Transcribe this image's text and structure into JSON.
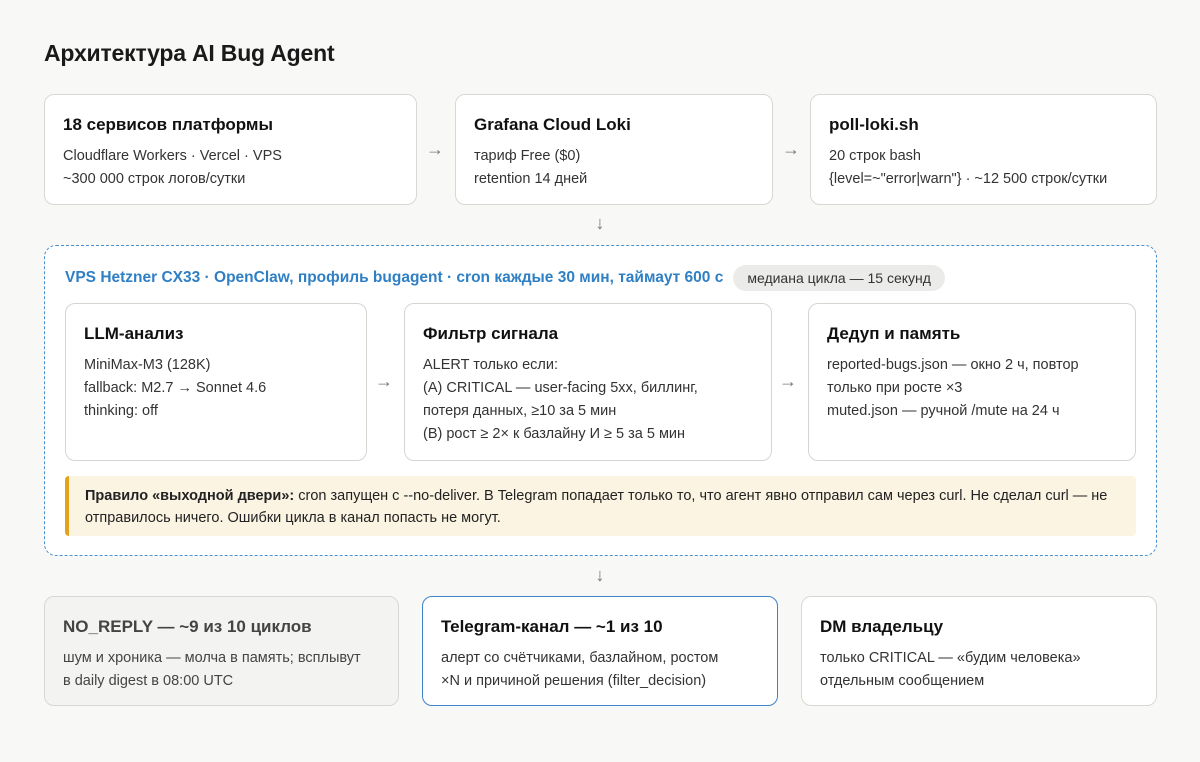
{
  "title": "Архитектура AI Bug Agent",
  "arrows": {
    "right": "→",
    "down": "↓"
  },
  "top_row": [
    {
      "title": "18 сервисов платформы",
      "lines": [
        "Cloudflare Workers · Vercel · VPS",
        "~300 000 строк логов/сутки"
      ]
    },
    {
      "title": "Grafana Cloud Loki",
      "lines": [
        "тариф Free ($0)",
        "retention 14 дней"
      ]
    },
    {
      "title": "poll-loki.sh",
      "lines": [
        "20 строк bash",
        "{level=~\"error|warn\"} · ~12 500 строк/сутки"
      ]
    }
  ],
  "vps": {
    "title": "VPS Hetzner CX33 · OpenClaw, профиль bugagent · cron каждые 30 мин, таймаут 600 с",
    "badge": "медиана цикла — 15 секунд",
    "cards": [
      {
        "title": "LLM-анализ",
        "lines": [
          "MiniMax-M3 (128K)",
          "fallback: M2.7 → Sonnet 4.6",
          "thinking: off"
        ]
      },
      {
        "title": "Фильтр сигнала",
        "lines": [
          "ALERT только если:",
          "(A) CRITICAL — user-facing 5xx, биллинг,",
          "потеря данных, ≥10 за 5 мин",
          "(B) рост ≥ 2× к базлайну И ≥ 5 за 5 мин"
        ]
      },
      {
        "title": "Дедуп и память",
        "lines": [
          "reported-bugs.json — окно 2 ч, повтор",
          "только при росте ×3",
          "muted.json — ручной /mute на 24 ч"
        ]
      }
    ],
    "rule_label": "Правило «выходной двери»:",
    "rule_text": " cron запущен с --no-deliver. В Telegram попадает только то, что агент явно отправил сам через curl. Не сделал curl — не отправилось ничего. Ошибки цикла в канал попасть не могут."
  },
  "bottom_row": [
    {
      "title": "NO_REPLY — ~9 из 10 циклов",
      "lines": [
        "шум и хроника — молча в память; всплывут",
        "в daily digest в 08:00 UTC"
      ]
    },
    {
      "title": "Telegram-канал — ~1 из 10",
      "lines": [
        "алерт со счётчиками, базлайном, ростом",
        "×N и причиной решения (filter_decision)"
      ]
    },
    {
      "title": "DM владельцу",
      "lines": [
        "только CRITICAL — «будим человека»",
        "отдельным сообщением"
      ]
    }
  ],
  "colors": {
    "accent": "#2f7fc4",
    "rule_bar": "#e2a31a",
    "rule_bg": "#fcf4e3"
  }
}
